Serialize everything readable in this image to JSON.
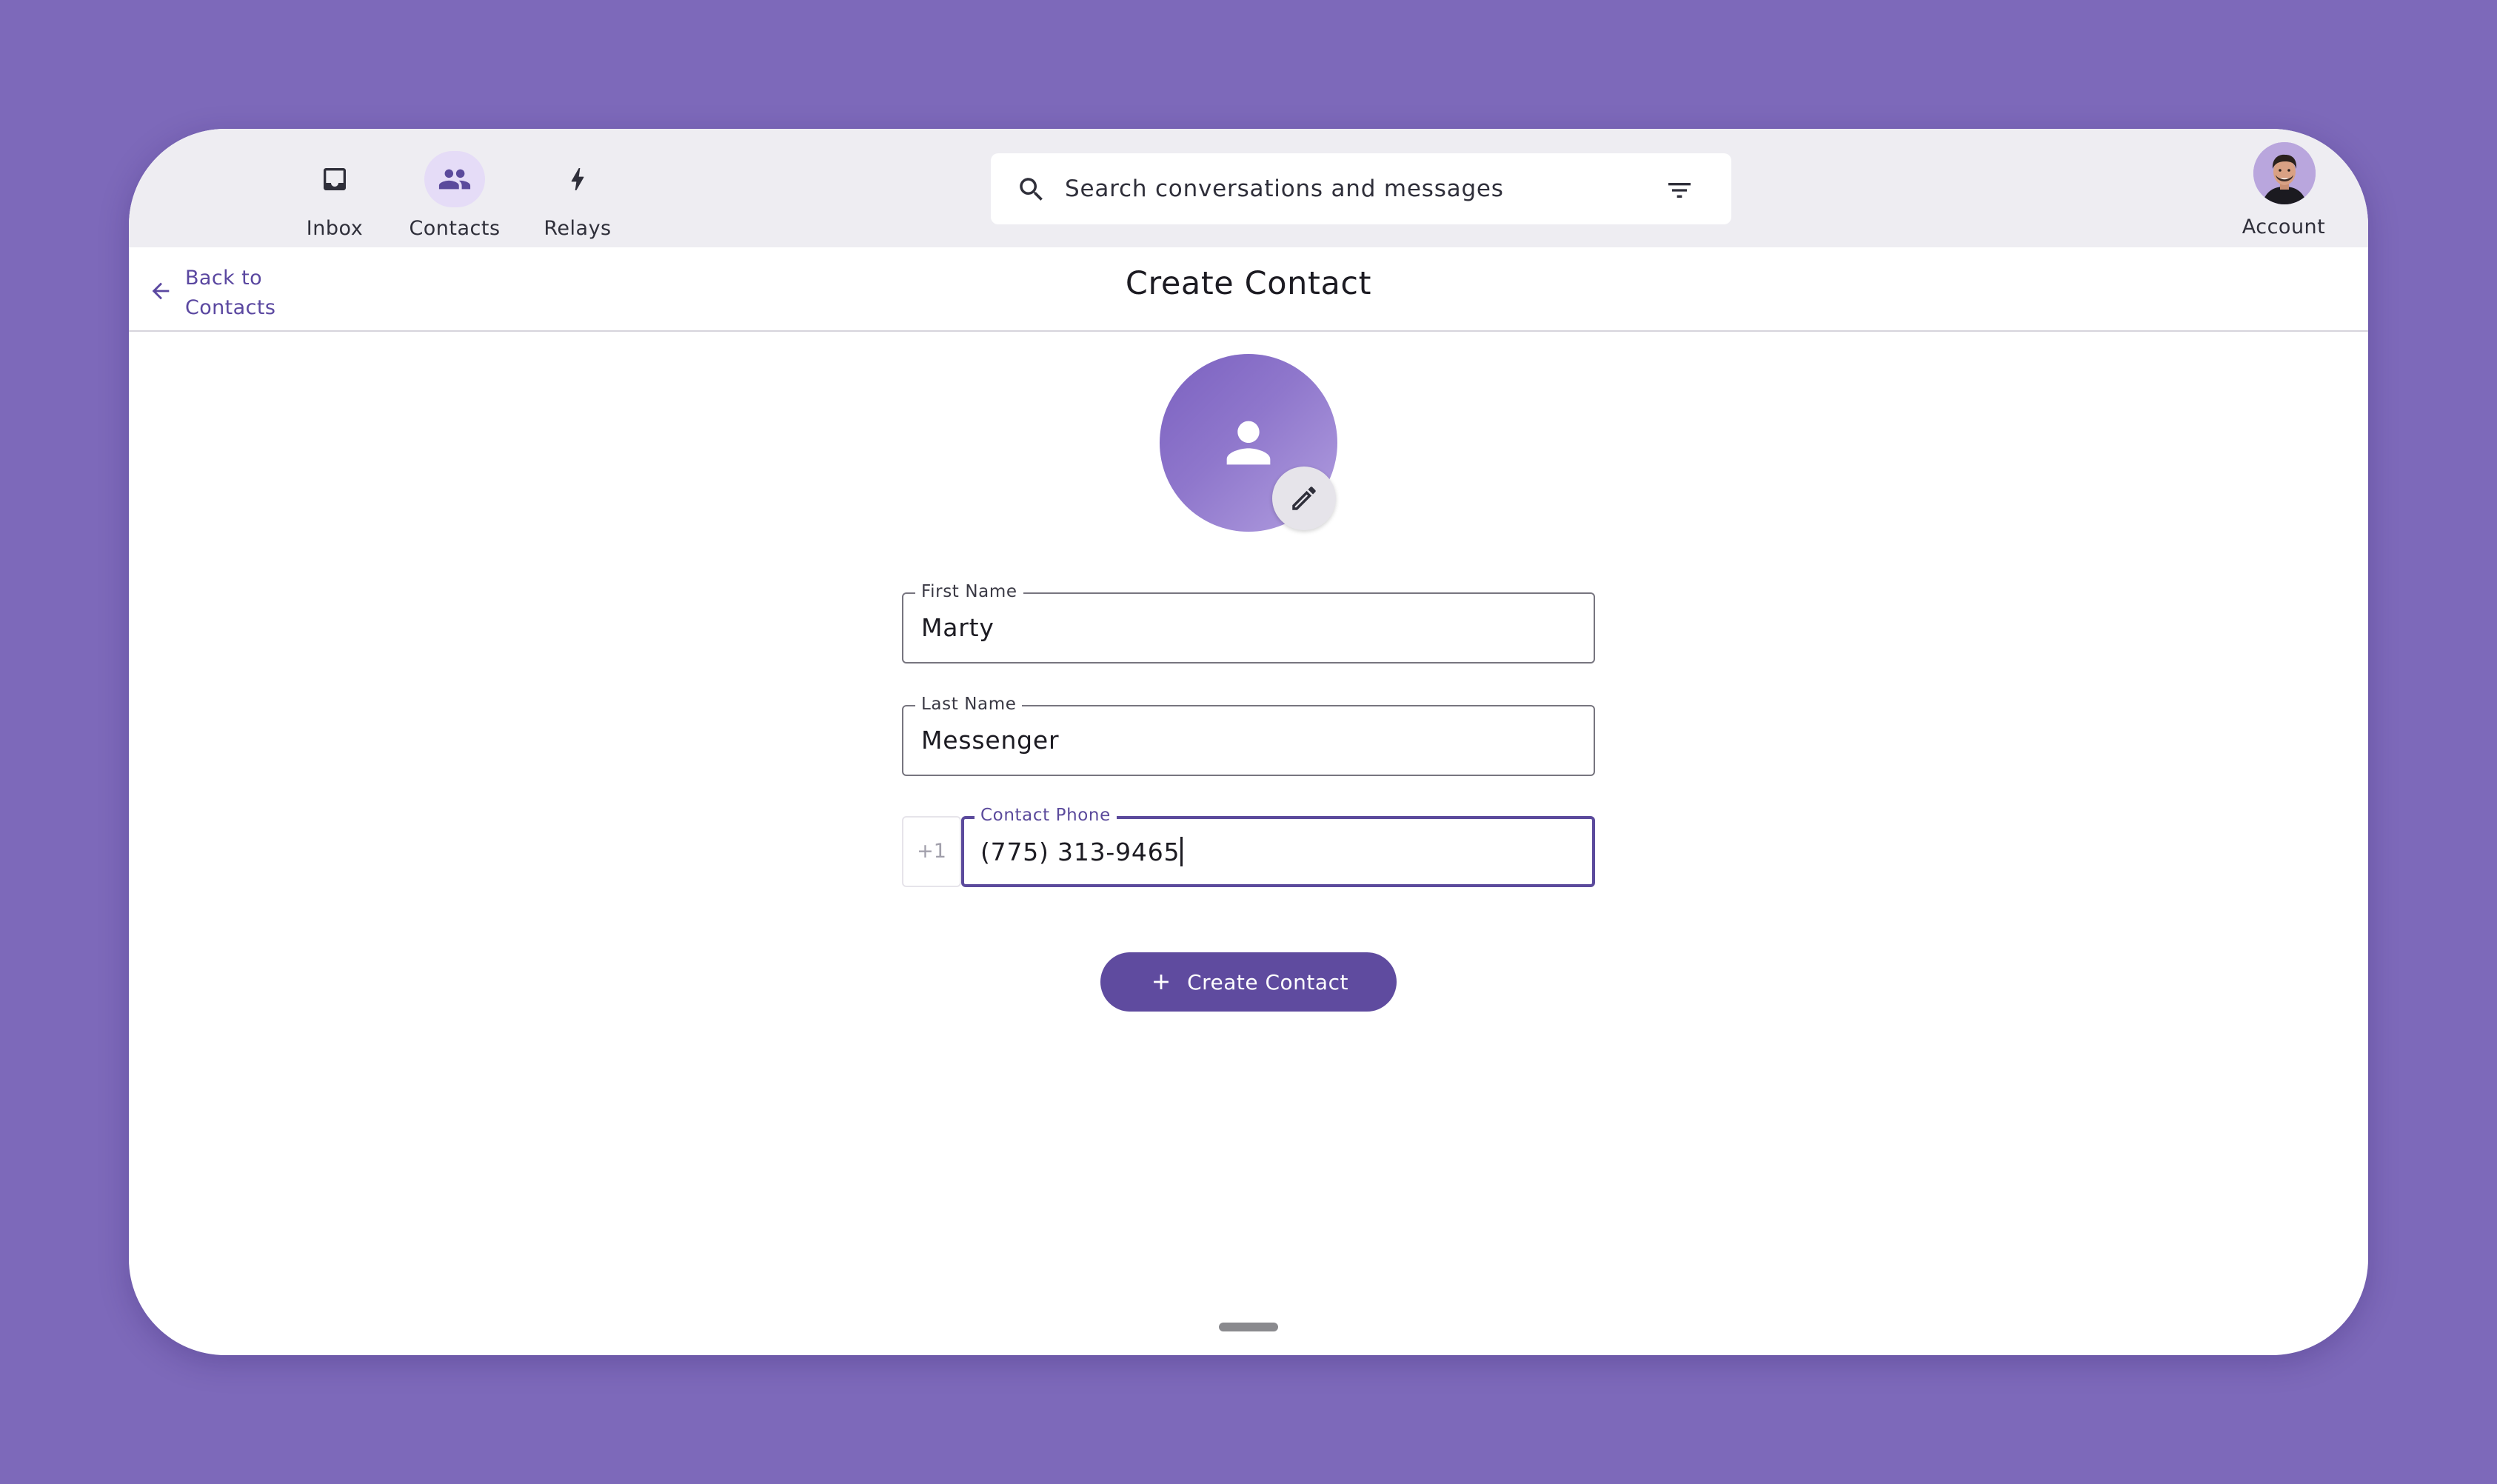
{
  "nav": {
    "items": [
      {
        "label": "Inbox",
        "icon": "inbox-icon",
        "active": false
      },
      {
        "label": "Contacts",
        "icon": "contacts-icon",
        "active": true
      },
      {
        "label": "Relays",
        "icon": "bolt-icon",
        "active": false
      }
    ]
  },
  "search": {
    "placeholder": "Search conversations and messages",
    "icon": "search-icon",
    "filter_icon": "filter-icon"
  },
  "account": {
    "label": "Account"
  },
  "header": {
    "back_line1": "Back to",
    "back_line2": "Contacts",
    "title": "Create Contact"
  },
  "form": {
    "first_name": {
      "label": "First Name",
      "value": "Marty"
    },
    "last_name": {
      "label": "Last Name",
      "value": "Messenger"
    },
    "phone": {
      "prefix": "+1",
      "label": "Contact Phone",
      "value": "(775) 313-9465"
    },
    "submit_label": "Create Contact"
  },
  "colors": {
    "background": "#7d69ba",
    "accent": "#5f4b9f",
    "active_nav_pill": "#e5dcf7",
    "topbar": "#eeedf2"
  }
}
